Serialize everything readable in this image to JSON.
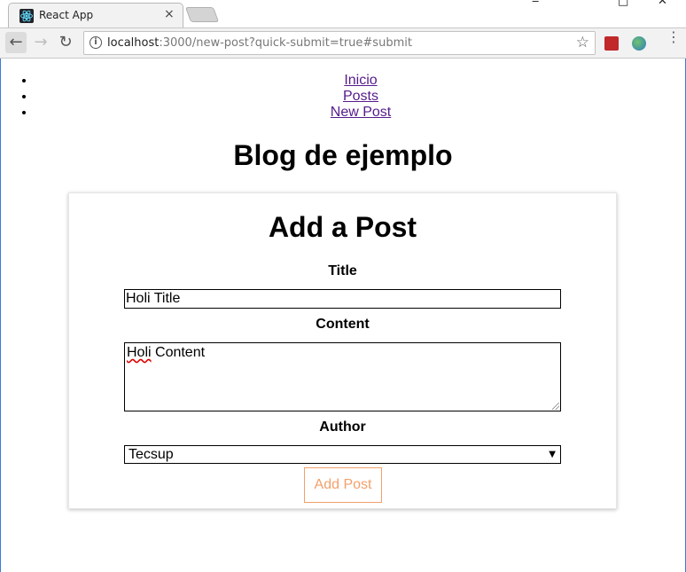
{
  "browser": {
    "tab_title": "React App",
    "tab_close": "×",
    "url_host": "localhost",
    "url_rest": ":3000/new-post?quick-submit=true#submit",
    "window_minimize": "‒",
    "window_maximize": "□",
    "window_close": "✕"
  },
  "nav": {
    "items": [
      {
        "label": "Inicio"
      },
      {
        "label": "Posts"
      },
      {
        "label": "New Post"
      }
    ]
  },
  "site_title": "Blog de ejemplo",
  "form": {
    "heading": "Add a Post",
    "title_label": "Title",
    "title_value": "Holi Title",
    "content_label": "Content",
    "content_value_word1": "Holi",
    "content_value_rest": " Content",
    "author_label": "Author",
    "author_selected": "Tecsup",
    "submit_label": "Add Post"
  },
  "colors": {
    "link": "#551a8b",
    "submit_accent": "#f2a06b",
    "window_border": "#3a7bd5"
  }
}
